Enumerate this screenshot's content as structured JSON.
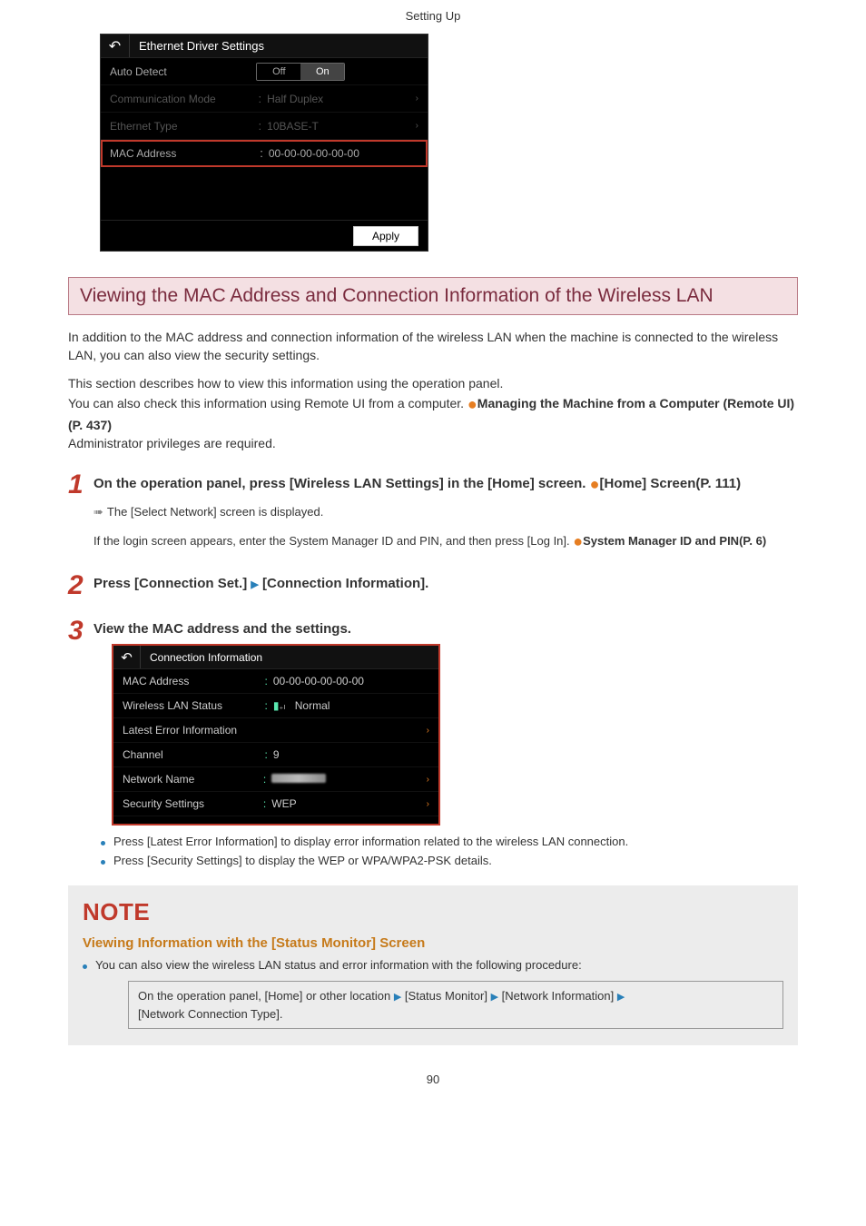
{
  "header": {
    "title": "Setting Up"
  },
  "panel1": {
    "title": "Ethernet Driver Settings",
    "rows": [
      {
        "label": "Auto Detect",
        "toggle": {
          "off": "Off",
          "on": "On"
        }
      },
      {
        "label": "Communication Mode",
        "value": "Half Duplex"
      },
      {
        "label": "Ethernet Type",
        "value": "10BASE-T"
      },
      {
        "label": "MAC Address",
        "value": "00-00-00-00-00-00"
      }
    ],
    "apply": "Apply"
  },
  "section_heading": "Viewing the MAC Address and Connection Information of the Wireless LAN",
  "intro1": "In addition to the MAC address and connection information of the wireless LAN when the machine is connected to the wireless LAN, you can also view the security settings.",
  "intro2a": "This section describes how to view this information using the operation panel.",
  "intro2b_pre": "You can also check this information using Remote UI from a computer. ",
  "intro2b_link": "Managing the Machine from a Computer (Remote UI)(P. 437)",
  "intro3": "Administrator privileges are required.",
  "step1": {
    "num": "1",
    "title_pre": "On the operation panel, press [Wireless LAN Settings] in the [Home] screen. ",
    "title_link": "[Home] Screen(P. 111)",
    "line1": "The [Select Network] screen is displayed.",
    "line2_pre": "If the login screen appears, enter the System Manager ID and PIN, and then press [Log In]. ",
    "line2_link": "System Manager ID and PIN(P. 6)"
  },
  "step2": {
    "num": "2",
    "title_a": "Press [Connection Set.] ",
    "title_b": " [Connection Information]."
  },
  "step3": {
    "num": "3",
    "title": "View the MAC address and the settings."
  },
  "panel2": {
    "title": "Connection Information",
    "rows": [
      {
        "label": "MAC Address",
        "value": "00-00-00-00-00-00"
      },
      {
        "label": "Wireless LAN Status",
        "value": "Normal",
        "signal": true
      },
      {
        "label": "Latest Error Information",
        "value": "",
        "chevron": true
      },
      {
        "label": "Channel",
        "value": "9"
      },
      {
        "label": "Network Name",
        "blurred": true,
        "chevron": true
      },
      {
        "label": "Security Settings",
        "value": "WEP",
        "chevron": true
      }
    ]
  },
  "bullets": [
    "Press [Latest Error Information] to display error information related to the wireless LAN connection.",
    "Press [Security Settings] to display the WEP or WPA/WPA2-PSK details."
  ],
  "note": {
    "title": "NOTE",
    "sub": "Viewing Information with the [Status Monitor] Screen",
    "li": "You can also view the wireless LAN status and error information with the following procedure:",
    "box_parts": {
      "a": "On the operation panel, [Home] or other location ",
      "b": " [Status Monitor] ",
      "c": " [Network Information] ",
      "d": " [Network Connection Type]."
    }
  },
  "pagenum": "90"
}
